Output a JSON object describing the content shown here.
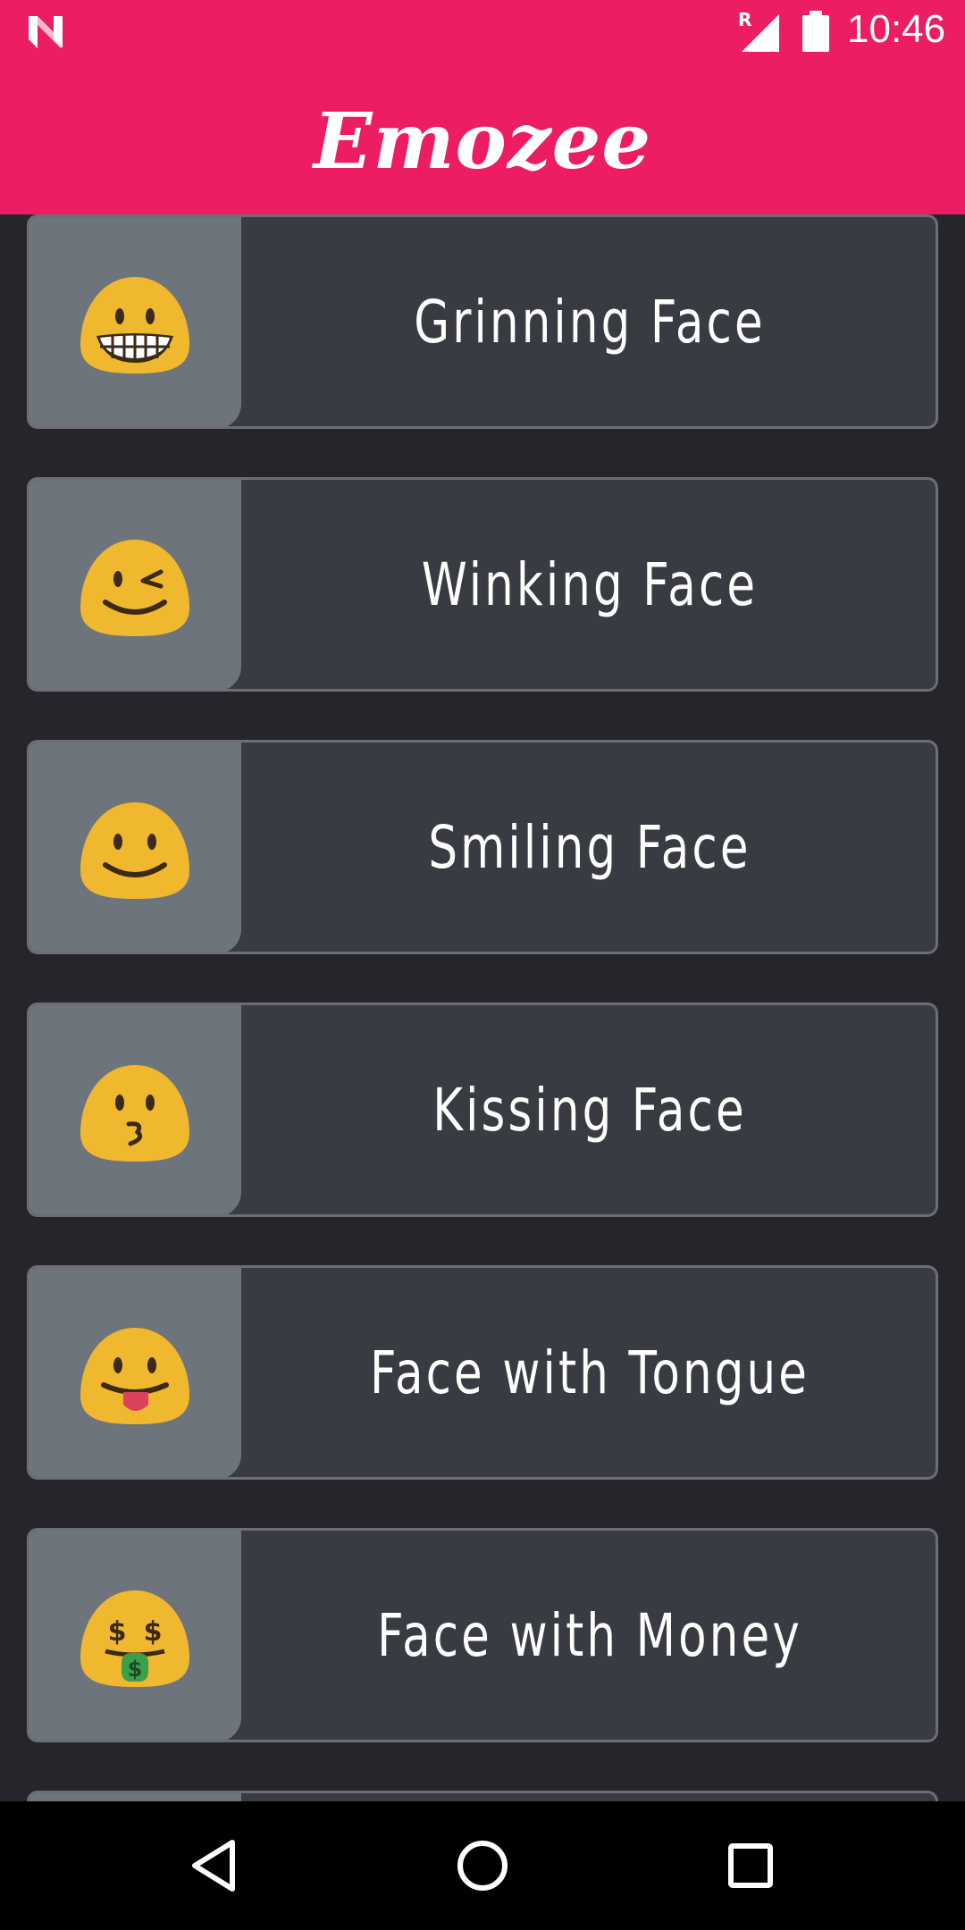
{
  "status_bar": {
    "time": "10:46",
    "network_badge": "R",
    "icons": [
      "n-logo-icon",
      "signal-icon",
      "battery-icon"
    ]
  },
  "app": {
    "title": "Emozee",
    "accent_color": "#ec1d63"
  },
  "emojis": [
    {
      "label": "Grinning Face",
      "icon": "grinning-face-icon"
    },
    {
      "label": "Winking Face",
      "icon": "winking-face-icon"
    },
    {
      "label": "Smiling Face",
      "icon": "smiling-face-icon"
    },
    {
      "label": "Kissing Face",
      "icon": "kissing-face-icon"
    },
    {
      "label": "Face with Tongue",
      "icon": "face-with-tongue-icon"
    },
    {
      "label": "Face with Money",
      "icon": "face-with-money-icon"
    }
  ],
  "nav_bar": {
    "buttons": [
      "back-icon",
      "home-icon",
      "recents-icon"
    ]
  }
}
